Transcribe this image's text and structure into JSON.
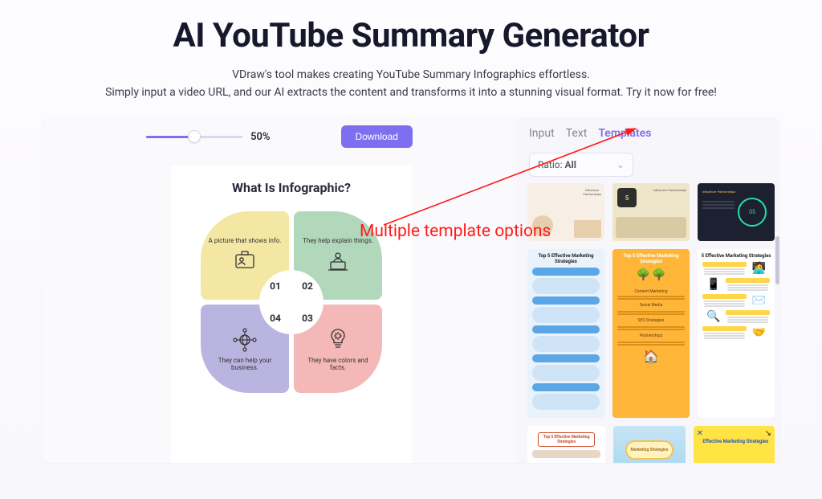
{
  "page": {
    "title": "AI YouTube Summary Generator",
    "subtitle_line1": "VDraw's tool makes creating YouTube Summary Infographics effortless.",
    "subtitle_line2": "Simply input a video URL, and our AI extracts the content and transforms it into a stunning visual format. Try it now for free!"
  },
  "toolbar": {
    "zoom_percent": "50%",
    "download_label": "Download"
  },
  "tabs": {
    "input": "Input",
    "text": "Text",
    "templates": "Templates"
  },
  "ratio": {
    "label": "Ratio:",
    "value": "All"
  },
  "infographic": {
    "title": "What Is Infographic?",
    "petals": {
      "p1": {
        "caption": "A picture that shows info.",
        "num": "01"
      },
      "p2": {
        "caption": "They help explain things.",
        "num": "02"
      },
      "p3": {
        "caption": "They have colors and facts.",
        "num": "03"
      },
      "p4": {
        "caption": "They can help your business.",
        "num": "04"
      }
    }
  },
  "templates": {
    "row2": {
      "t1_title": "Top 5 Effective Marketing Strategies",
      "t2_title": "Top 5 Effective Marketing Strategies",
      "t3_title": "5 Effective Marketing Strategies"
    },
    "row3": {
      "t1_title": "Top 5 Effective Marketing Strategies",
      "t2_title": "Marketing Strategies",
      "t3_title": "Effective Marketing Strategies"
    }
  },
  "annotation": {
    "text": "Multiple template options"
  }
}
